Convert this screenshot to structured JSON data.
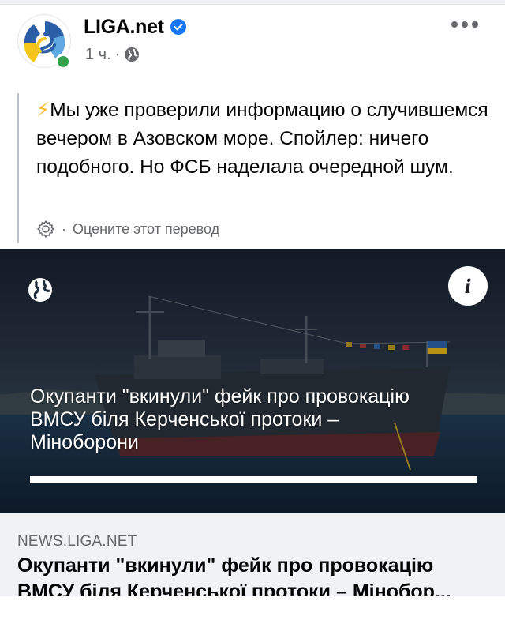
{
  "header": {
    "page_name": "LIGA.net",
    "time": "1 ч.",
    "separator": "·",
    "icons": [
      "verified-badge-icon",
      "globe-icon",
      "more-options-icon"
    ]
  },
  "post": {
    "bolt_emoji": "⚡",
    "text": "Мы уже проверили информацию о случившемся вечером в Азовском море. Спойлер: ничего подобного. Но ФСБ наделала очередной шум.",
    "translate_prefix": "·",
    "translate_label": "Оцените этот перевод"
  },
  "link_card": {
    "image_title": "Окупанти \"вкинули\" фейк про провокацію ВМСУ біля Керченської протоки – Міноборони",
    "info_symbol": "i",
    "domain": "NEWS.LIGA.NET",
    "title": "Окупанти \"вкинули\" фейк про провокацію ВМСУ біля Керченської протоки – Мінобор..."
  },
  "colors": {
    "secondary_text": "#65676b",
    "verified_blue": "#1877f2",
    "online_green": "#31a24c",
    "link_box_bg": "#f0f2f5",
    "logo_blue": "#2a5fa8",
    "logo_yellow": "#f5c518"
  }
}
